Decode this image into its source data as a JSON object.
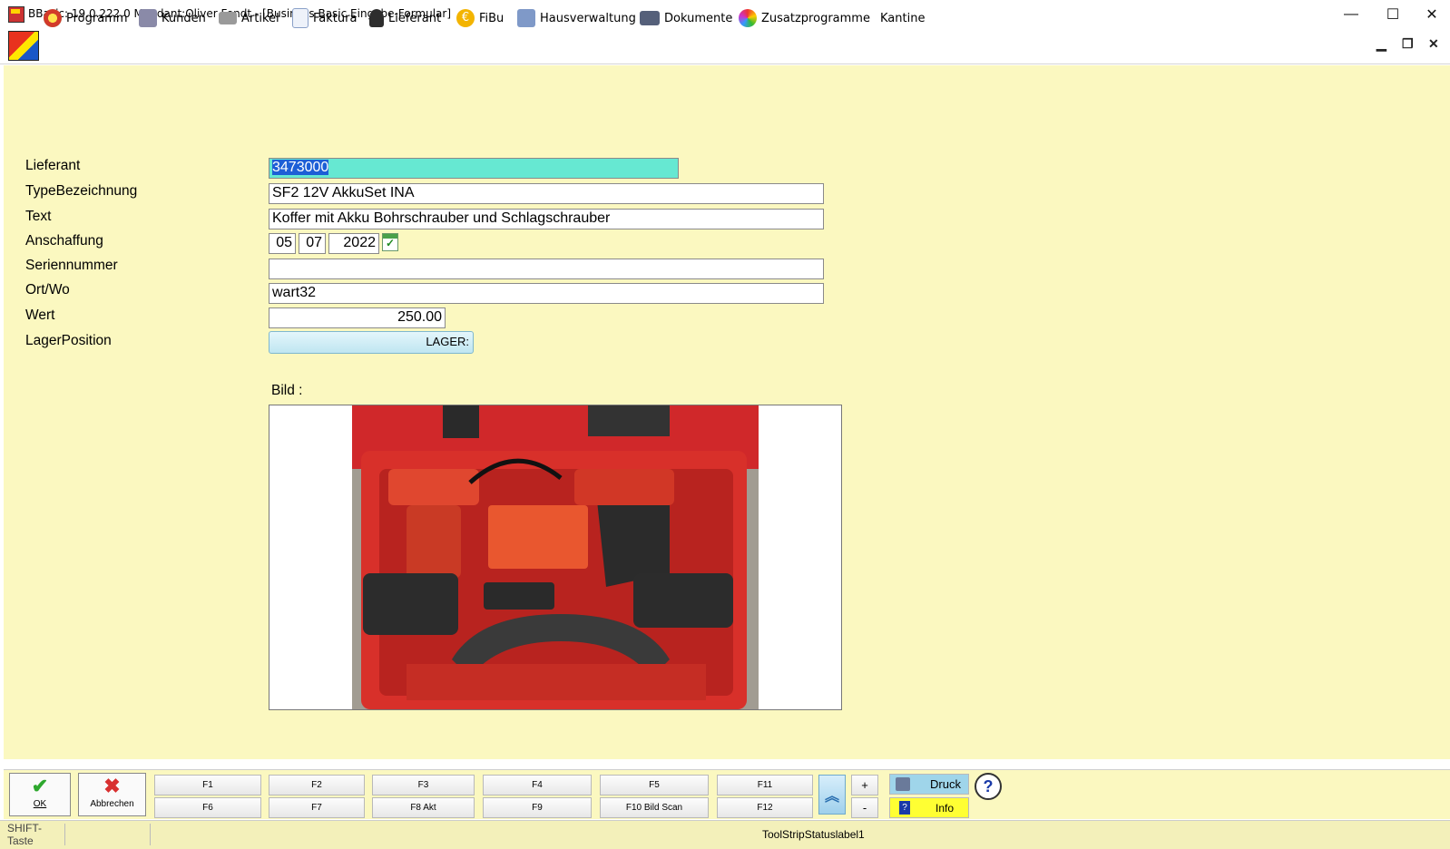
{
  "window": {
    "title": "BBasic: 19.0.222.0 Mandant:Oliver Fendt  - [Business Basic Eingabe-Formular]",
    "minimize": "—",
    "maximize": "☐",
    "close": "✕"
  },
  "menu": {
    "items": [
      {
        "label": "Programm",
        "icon": "programm-icon",
        "color": "#d23a2a"
      },
      {
        "label": "Kunden",
        "icon": "kunden-icon",
        "color": "#6b6b8a"
      },
      {
        "label": "Artikel",
        "icon": "artikel-icon",
        "color": "#7a7a7a"
      },
      {
        "label": "Faktura",
        "icon": "faktura-icon",
        "color": "#8aa0c8"
      },
      {
        "label": "Lieferant",
        "icon": "lieferant-icon",
        "color": "#333333"
      },
      {
        "label": "FiBu",
        "icon": "euro-icon",
        "color": "#e8a200"
      },
      {
        "label": "Hausverwaltung",
        "icon": "house-icon",
        "color": "#6c8bc0"
      },
      {
        "label": "Dokumente",
        "icon": "dokumente-icon",
        "color": "#55607a"
      },
      {
        "label": "Zusatzprogramme",
        "icon": "zusatz-icon",
        "color": "#c060c0"
      },
      {
        "label": "Kantine",
        "icon": "",
        "color": ""
      }
    ],
    "mdi_min": "▁",
    "mdi_restore": "❐",
    "mdi_close": "✕"
  },
  "form": {
    "labels": {
      "lieferant": "Lieferant",
      "typebezeichnung": "TypeBezeichnung",
      "text": "Text",
      "anschaffung": "Anschaffung",
      "seriennummer": "Seriennummer",
      "ortwo": "Ort/Wo",
      "wert": "Wert",
      "lagerposition": "LagerPosition",
      "bild": "Bild :"
    },
    "values": {
      "lieferant": "3473000",
      "typebezeichnung": "SF2 12V AkkuSet INA",
      "text": "Koffer mit Akku Bohrschrauber und Schlagschrauber",
      "anschaffung_day": "05",
      "anschaffung_month": "07",
      "anschaffung_year": "2022",
      "seriennummer": "",
      "ortwo": "wart32",
      "wert": "250.00",
      "lagerposition": "LAGER:"
    },
    "selection_color": "#66e8d2"
  },
  "toolbar": {
    "ok": "OK",
    "abbrechen": "Abbrechen",
    "fkeys_top": [
      "F1",
      "F2",
      "F3",
      "F4",
      "F5",
      "F11"
    ],
    "fkeys_bottom": [
      "F6",
      "F7",
      "F8 Akt",
      "F9",
      "F10 Bild Scan",
      "F12"
    ],
    "plus": "+",
    "minus": "-",
    "druck": "Druck",
    "info": "Info",
    "help": "?"
  },
  "statusbar": {
    "shift": "SHIFT-Taste",
    "label1": "ToolStripStatuslabel1"
  },
  "colors": {
    "form_background": "#fbf8c0",
    "druck_button": "#9fd5ea",
    "info_button": "#ffff33"
  }
}
